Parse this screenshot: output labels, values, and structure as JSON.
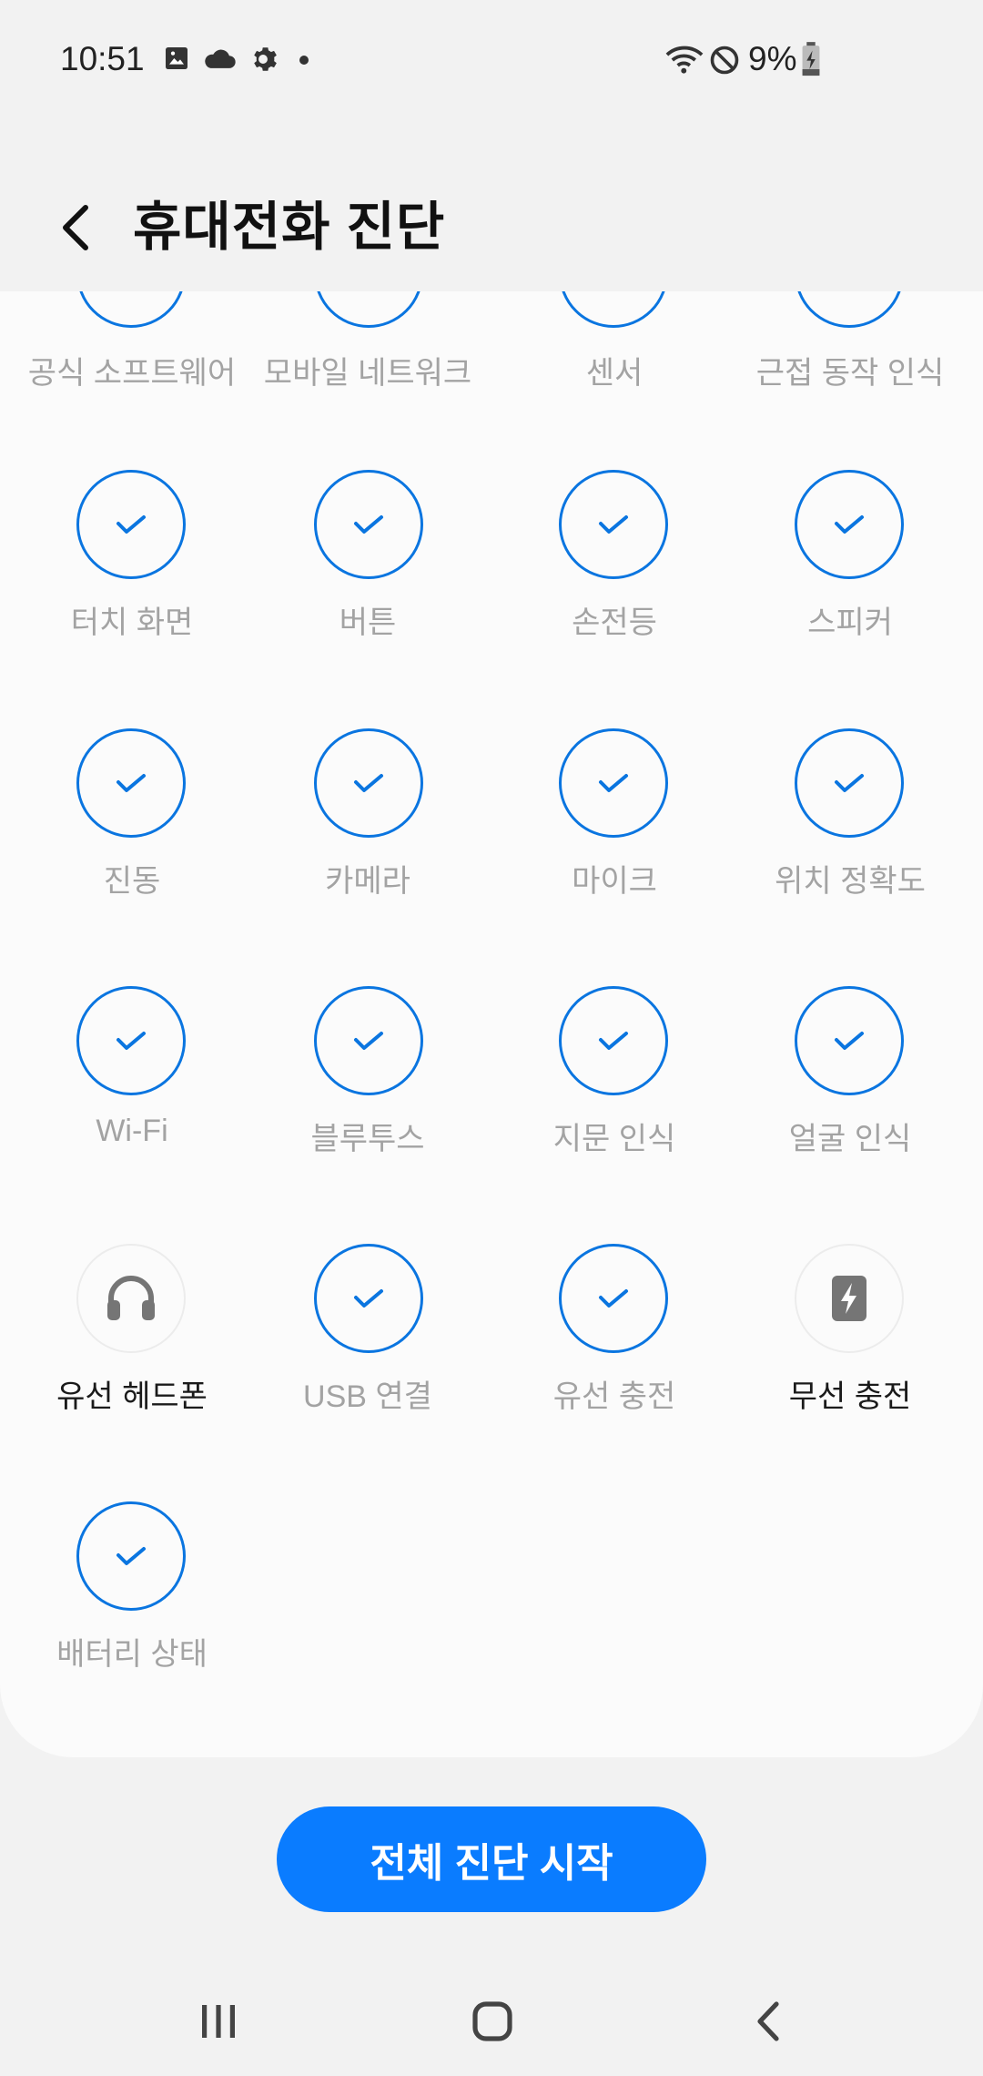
{
  "status_bar": {
    "time": "10:51",
    "battery_percent": "9%",
    "icons": [
      "image-icon",
      "cloud-icon",
      "settings-gear-icon",
      "dot-icon",
      "wifi-icon",
      "do-not-disturb-icon",
      "battery-charging-icon"
    ]
  },
  "header": {
    "back_icon": "chevron-left-icon",
    "title": "휴대전화 진단"
  },
  "top_row_labels": [
    "공식 소프트웨어",
    "모바일 네트워크",
    "센서",
    "근접 동작 인식"
  ],
  "tests": [
    {
      "label": "터치 화면",
      "status": "passed"
    },
    {
      "label": "버튼",
      "status": "passed"
    },
    {
      "label": "손전등",
      "status": "passed"
    },
    {
      "label": "스피커",
      "status": "passed"
    },
    {
      "label": "진동",
      "status": "passed"
    },
    {
      "label": "카메라",
      "status": "passed"
    },
    {
      "label": "마이크",
      "status": "passed"
    },
    {
      "label": "위치 정확도",
      "status": "passed"
    },
    {
      "label": "Wi-Fi",
      "status": "passed"
    },
    {
      "label": "블루투스",
      "status": "passed"
    },
    {
      "label": "지문 인식",
      "status": "passed"
    },
    {
      "label": "얼굴 인식",
      "status": "passed"
    },
    {
      "label": "유선 헤드폰",
      "status": "not-tested",
      "icon": "headphones-icon"
    },
    {
      "label": "USB 연결",
      "status": "passed"
    },
    {
      "label": "유선 충전",
      "status": "passed"
    },
    {
      "label": "무선 충전",
      "status": "not-tested",
      "icon": "wireless-charging-icon"
    },
    {
      "label": "배터리 상태",
      "status": "passed"
    }
  ],
  "start_button": "전체 진단 시작",
  "nav": [
    "recent-apps-icon",
    "home-icon",
    "back-icon"
  ],
  "colors": {
    "accent": "#0a7cff",
    "check": "#0a75e0"
  }
}
